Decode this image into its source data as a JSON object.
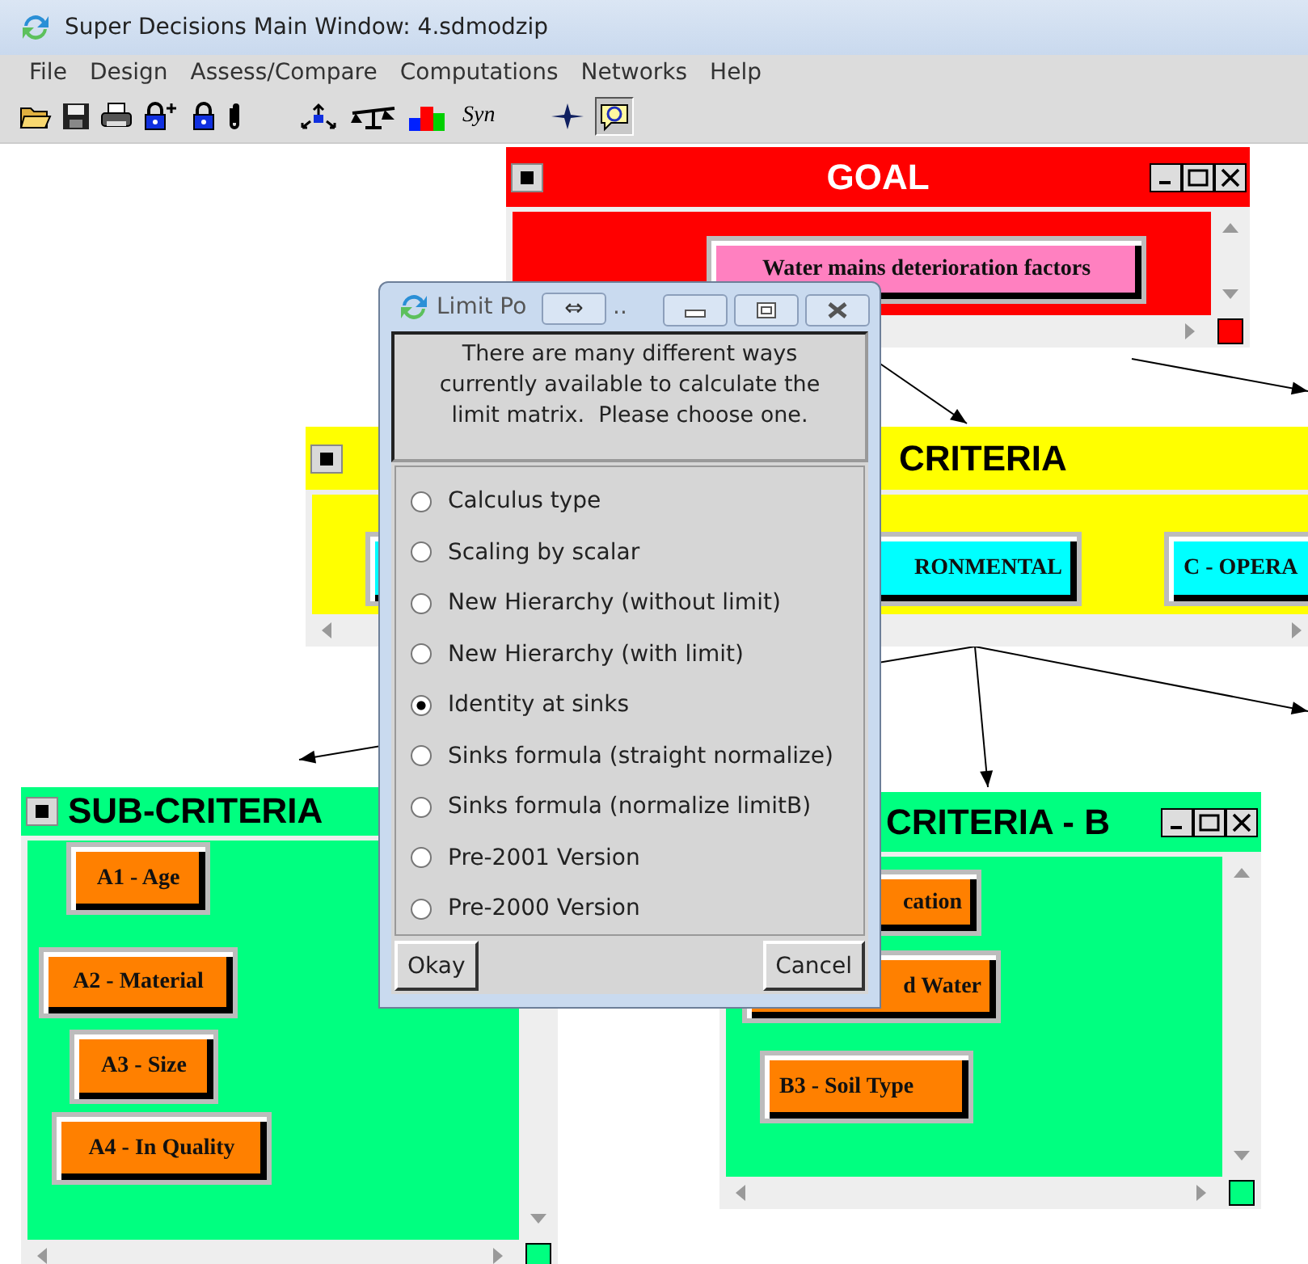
{
  "window": {
    "title": "Super Decisions Main Window: 4.sdmodzip"
  },
  "menu": [
    "File",
    "Design",
    "Assess/Compare",
    "Computations",
    "Networks",
    "Help"
  ],
  "toolbar": {
    "text_button": "Syn",
    "help_pressed": true
  },
  "clusters": [
    {
      "title": "GOAL",
      "color": "#ff0000",
      "nodes": [
        {
          "kind": "labeled",
          "label": "Water mains deterioration factors",
          "color": "#ff80c0"
        }
      ]
    },
    {
      "title": "CRITERIA",
      "color": "#ffff00",
      "nodes": [
        {
          "kind": "covered",
          "color": "#00ffff"
        },
        {
          "kind": "labeled",
          "label": "RONMENTAL",
          "color": "#00ffff"
        },
        {
          "kind": "labeled",
          "label": "C - OPERA",
          "color": "#00ffff"
        }
      ]
    },
    {
      "title": "SUB-CRITERIA",
      "color": "#00ff80",
      "nodes": [
        {
          "kind": "labeled",
          "label": "A1 - Age",
          "color": "#ff8000"
        },
        {
          "kind": "labeled",
          "label": "A2 - Material",
          "color": "#ff8000"
        },
        {
          "kind": "labeled",
          "label": "A3 - Size",
          "color": "#ff8000"
        },
        {
          "kind": "labeled",
          "label": "A4 - In Quality",
          "color": "#ff8000"
        }
      ]
    },
    {
      "title": "CRITERIA - B",
      "color": "#00ff80",
      "nodes": [
        {
          "kind": "labeled",
          "label": "cation",
          "color": "#ff8000"
        },
        {
          "kind": "labeled",
          "label": "d Water",
          "color": "#ff8000"
        },
        {
          "kind": "labeled",
          "label": "B3 - Soil Type",
          "color": "#ff8000"
        }
      ]
    }
  ],
  "dialog": {
    "title": "Limit Po",
    "title_end": "..",
    "swap_button": "⇔",
    "message": "There are many different ways currently available to calculate the limit matrix.  Please choose one.",
    "options": [
      {
        "label": "Calculus type",
        "selected": false
      },
      {
        "label": "Scaling by scalar",
        "selected": false
      },
      {
        "label": "New Hierarchy (without limit)",
        "selected": false
      },
      {
        "label": "New Hierarchy (with limit)",
        "selected": false
      },
      {
        "label": "Identity at sinks",
        "selected": true
      },
      {
        "label": "Sinks formula (straight normalize)",
        "selected": false
      },
      {
        "label": "Sinks formula (normalize limitB)",
        "selected": false
      },
      {
        "label": "Pre-2001 Version",
        "selected": false
      },
      {
        "label": "Pre-2000 Version",
        "selected": false
      }
    ],
    "buttons": [
      "Okay",
      "Cancel"
    ]
  }
}
